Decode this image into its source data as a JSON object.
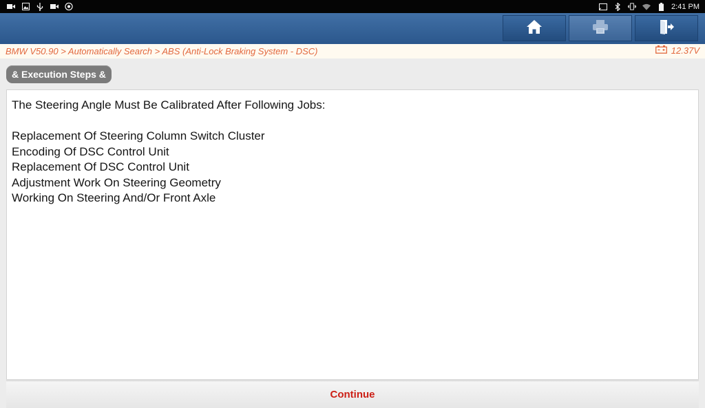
{
  "status_bar": {
    "left_icons": [
      "video-icon",
      "image-icon",
      "usb-icon",
      "video-icon",
      "settings-icon"
    ],
    "right_icons": [
      "cast-icon",
      "bluetooth-icon",
      "vibrate-icon",
      "wifi-icon",
      "battery-icon"
    ],
    "time": "2:41 PM"
  },
  "toolbar": {
    "buttons": [
      "home-icon",
      "print-icon",
      "exit-icon"
    ]
  },
  "breadcrumb": {
    "text": "BMW V50.90 > Automatically Search > ABS (Anti-Lock Braking System - DSC)",
    "voltage": "12.37V",
    "color": "#e2683e"
  },
  "steps_tab": {
    "label": "& Execution Steps &"
  },
  "content": {
    "lines": [
      "The Steering Angle Must Be Calibrated After Following Jobs:",
      "",
      "Replacement Of Steering Column Switch Cluster",
      "Encoding Of DSC Control Unit",
      "Replacement Of DSC Control Unit",
      "Adjustment Work On Steering Geometry",
      "Working On Steering And/Or Front Axle"
    ]
  },
  "footer": {
    "continue_label": "Continue",
    "continue_color": "#cc1f16"
  }
}
